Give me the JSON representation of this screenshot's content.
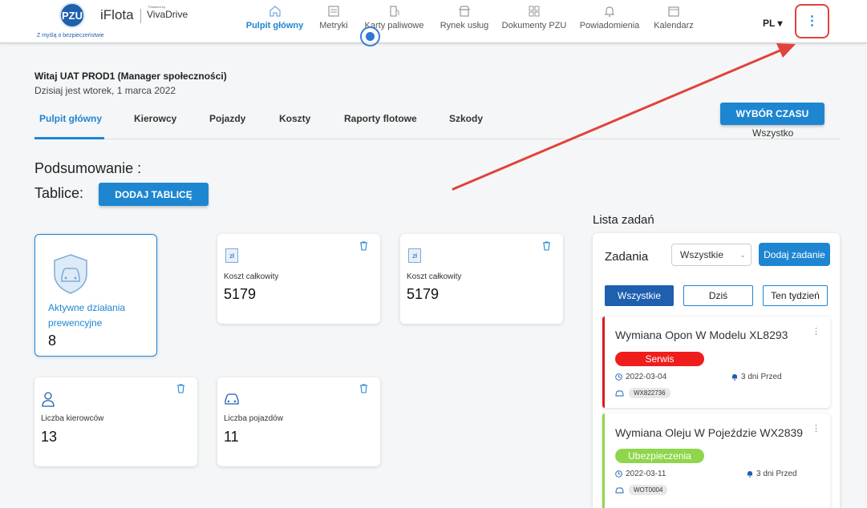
{
  "header": {
    "logo_text": "PZU",
    "brand": "iFlota",
    "brand_powered": "Powered by",
    "brand_partner": "VivaDrive",
    "tagline": "Z myślą o bezpieczeństwie",
    "nav": [
      {
        "label": "Pulpit główny",
        "icon": "home-icon"
      },
      {
        "label": "Metryki",
        "icon": "metrics-icon"
      },
      {
        "label": "Karty paliwowe",
        "icon": "fuel-icon"
      },
      {
        "label": "Rynek usług",
        "icon": "market-icon"
      },
      {
        "label": "Dokumenty PZU",
        "icon": "documents-icon"
      },
      {
        "label": "Powiadomienia",
        "icon": "bell-icon"
      },
      {
        "label": "Kalendarz",
        "icon": "calendar-icon"
      }
    ],
    "language": "PL ▾",
    "menu_glyph": "⋮"
  },
  "greeting": {
    "welcome": "Witaj UAT PROD1 (Manager społeczności)",
    "date": "Dzisiaj jest wtorek, 1 marca 2022"
  },
  "tabs": [
    "Pulpit główny",
    "Kierowcy",
    "Pojazdy",
    "Koszty",
    "Raporty flotowe",
    "Szkody"
  ],
  "time_filter": {
    "button": "WYBÓR CZASU",
    "value": "Wszystko"
  },
  "summary_heading": "Podsumowanie :",
  "boards_heading": "Tablice:",
  "add_board_button": "DODAJ TABLICĘ",
  "cards": {
    "preventive": {
      "label": "Aktywne działania prewencyjne",
      "value": "8"
    },
    "cost1": {
      "currency": "zł",
      "label": "Koszt całkowity",
      "value": "5179"
    },
    "cost2": {
      "currency": "zł",
      "label": "Koszt całkowity",
      "value": "5179"
    },
    "drivers": {
      "label": "Liczba kierowców",
      "value": "13"
    },
    "vehicles": {
      "label": "Liczba pojazdów",
      "value": "11"
    }
  },
  "tasks": {
    "title": "Lista zadań",
    "header": "Zadania",
    "filter_value": "Wszystkie",
    "add_button": "Dodaj zadanie",
    "segments": [
      "Wszystkie",
      "Dziś",
      "Ten tydzień"
    ],
    "items": [
      {
        "title": "Wymiana Opon W Modelu XL8293",
        "tag": "Serwis",
        "tag_color": "#f01d1d",
        "bar_color": "#e21b1b",
        "date": "2022-03-04",
        "ago": "3 dni Przed",
        "plate": "WX822736"
      },
      {
        "title": "Wymiana Oleju W Pojeździe WX2839",
        "tag": "Ubezpieczenia",
        "tag_color": "#8fd64b",
        "bar_color": "#8fd64b",
        "date": "2022-03-11",
        "ago": "3 dni Przed",
        "plate": "WOT0004"
      }
    ]
  },
  "colors": {
    "accent": "#1e86d1",
    "annotation": "#e0433b"
  }
}
